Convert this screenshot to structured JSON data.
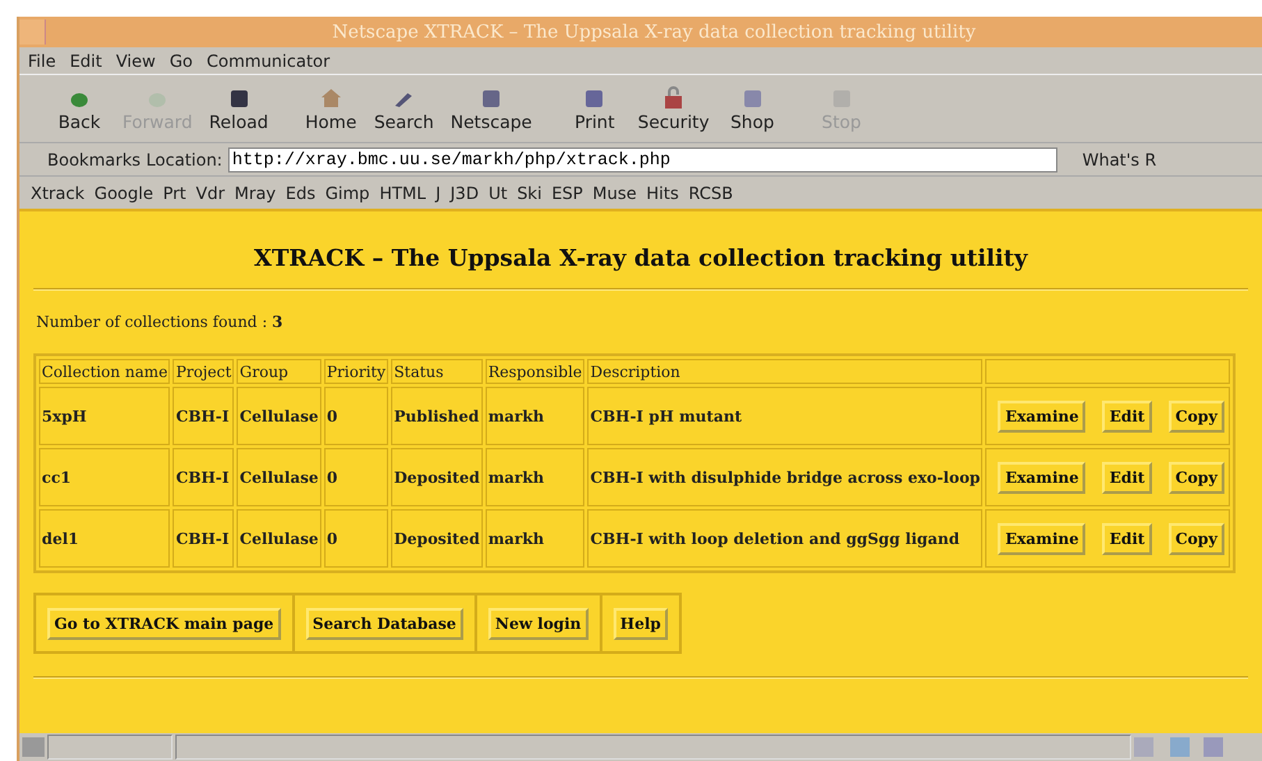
{
  "window": {
    "title": "Netscape XTRACK – The Uppsala X-ray data collection tracking utility"
  },
  "menu": [
    "File",
    "Edit",
    "View",
    "Go",
    "Communicator"
  ],
  "toolbar": [
    {
      "label": "Back",
      "kind": "back",
      "disabled": false
    },
    {
      "label": "Forward",
      "kind": "forward",
      "disabled": true
    },
    {
      "label": "Reload",
      "kind": "reload",
      "disabled": false
    },
    {
      "label": "Home",
      "kind": "home",
      "disabled": false
    },
    {
      "label": "Search",
      "kind": "search",
      "disabled": false
    },
    {
      "label": "Netscape",
      "kind": "netscape",
      "disabled": false
    },
    {
      "label": "Print",
      "kind": "print",
      "disabled": false
    },
    {
      "label": "Security",
      "kind": "security",
      "disabled": false
    },
    {
      "label": "Shop",
      "kind": "shop",
      "disabled": false
    },
    {
      "label": "Stop",
      "kind": "stop",
      "disabled": true
    }
  ],
  "location_bar": {
    "bookmarks": "Bookmarks",
    "location_label": "Location:",
    "url": "http://xray.bmc.uu.se/markh/php/xtrack.php",
    "related": "What's R"
  },
  "personal_toolbar": [
    "Xtrack",
    "Google",
    "Prt",
    "Vdr",
    "Mray",
    "Eds",
    "Gimp",
    "HTML",
    "J",
    "J3D",
    "Ut",
    "Ski",
    "ESP",
    "Muse",
    "Hits",
    "RCSB"
  ],
  "page": {
    "heading": "XTRACK – The Uppsala X-ray data collection tracking utility",
    "count_label": "Number of collections found :",
    "count": "3",
    "table": {
      "columns": [
        "Collection name",
        "Project",
        "Group",
        "Priority",
        "Status",
        "Responsible",
        "Description"
      ],
      "rows": [
        {
          "cells": [
            "5xpH",
            "CBH-I",
            "Cellulase",
            "0",
            "Published",
            "markh",
            "CBH-I pH mutant"
          ],
          "actions": [
            "Examine",
            "Edit",
            "Copy"
          ]
        },
        {
          "cells": [
            "cc1",
            "CBH-I",
            "Cellulase",
            "0",
            "Deposited",
            "markh",
            "CBH-I with disulphide bridge across exo-loop"
          ],
          "actions": [
            "Examine",
            "Edit",
            "Copy"
          ]
        },
        {
          "cells": [
            "del1",
            "CBH-I",
            "Cellulase",
            "0",
            "Deposited",
            "markh",
            "CBH-I with loop deletion and ggSgg ligand"
          ],
          "actions": [
            "Examine",
            "Edit",
            "Copy"
          ]
        }
      ]
    },
    "buttons": [
      "Go to XTRACK main page",
      "Search Database",
      "New login",
      "Help"
    ]
  }
}
